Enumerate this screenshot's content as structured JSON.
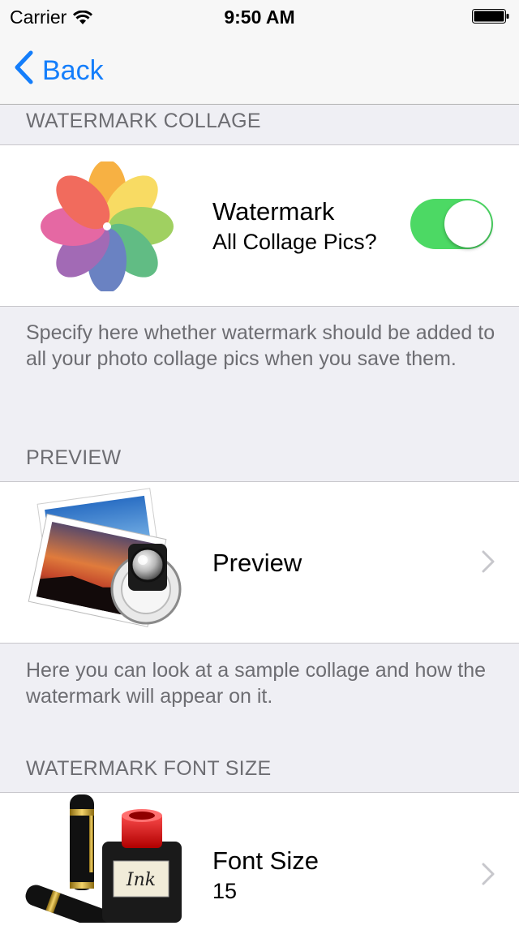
{
  "status_bar": {
    "carrier": "Carrier",
    "time": "9:50 AM"
  },
  "nav": {
    "back_label": "Back",
    "accent_color": "#147efb"
  },
  "sections": {
    "collage": {
      "header": "WATERMARK COLLAGE",
      "title": "Watermark",
      "subtitle": "All Collage Pics?",
      "toggle_on": true,
      "toggle_color": "#4cd964",
      "icon": "photos-flower-icon",
      "footer": "Specify here whether watermark should be added to all your photo collage pics when you save them."
    },
    "preview": {
      "header": "PREVIEW",
      "title": "Preview",
      "icon": "preview-photos-loupe-icon",
      "footer": "Here you can look at a sample collage and how the watermark will appear on it."
    },
    "font_size": {
      "header": "WATERMARK FONT SIZE",
      "title": "Font Size",
      "value": "15",
      "icon": "ink-pen-icon",
      "ink_label": "Ink"
    }
  }
}
